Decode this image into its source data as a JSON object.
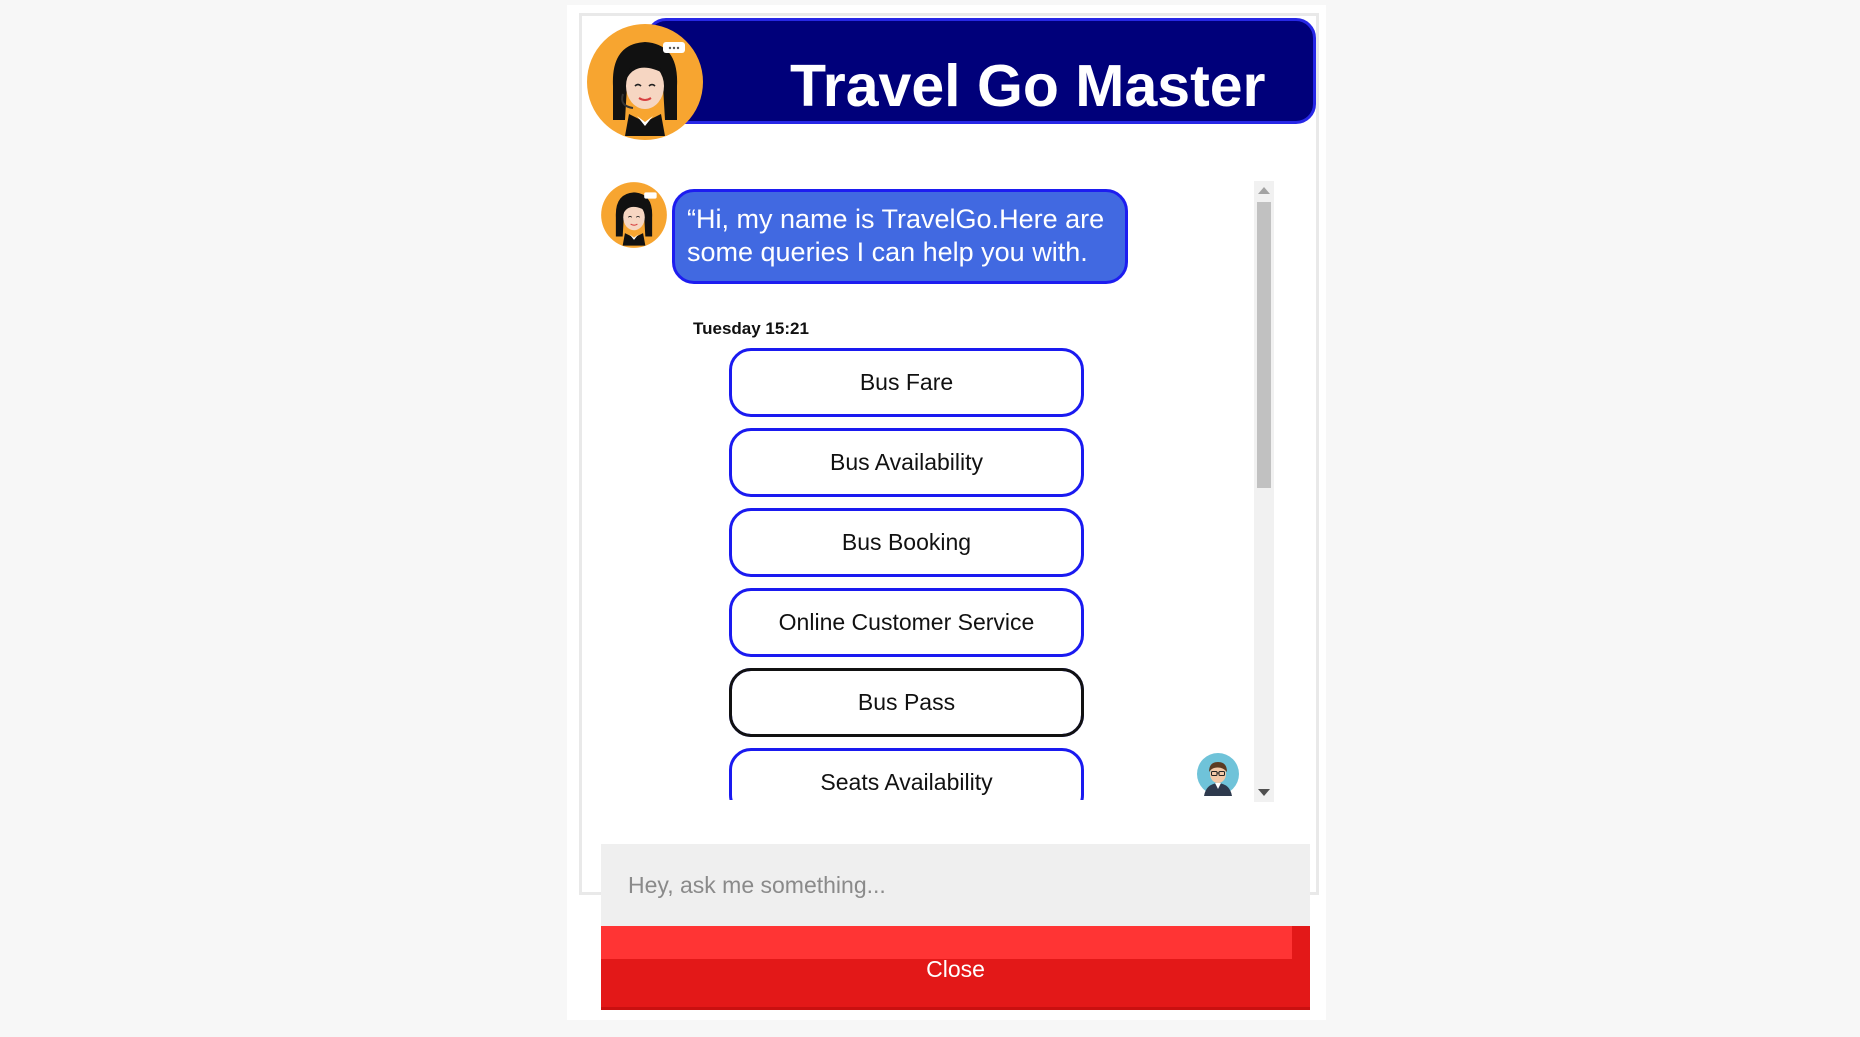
{
  "header": {
    "title": "Travel Go Master",
    "avatar_icon": "agent-woman-icon",
    "bar_color": "#00007a"
  },
  "chat": {
    "bot_avatar_icon": "agent-woman-icon",
    "greeting": "“Hi, my name is TravelGo.Here are some queries I can help you with.",
    "timestamp": "Tuesday 15:21",
    "bubble_color": "#4169e1",
    "options": [
      {
        "label": "Bus Fare"
      },
      {
        "label": "Bus Availability"
      },
      {
        "label": "Bus Booking"
      },
      {
        "label": "Online Customer Service"
      },
      {
        "label": "Bus Pass",
        "focused": true
      },
      {
        "label": "Seats Availability"
      }
    ],
    "user_avatar_icon": "user-man-icon"
  },
  "input": {
    "placeholder": "Hey, ask me something...",
    "value": ""
  },
  "close_button": {
    "label": "Close",
    "color": "#e31818"
  }
}
